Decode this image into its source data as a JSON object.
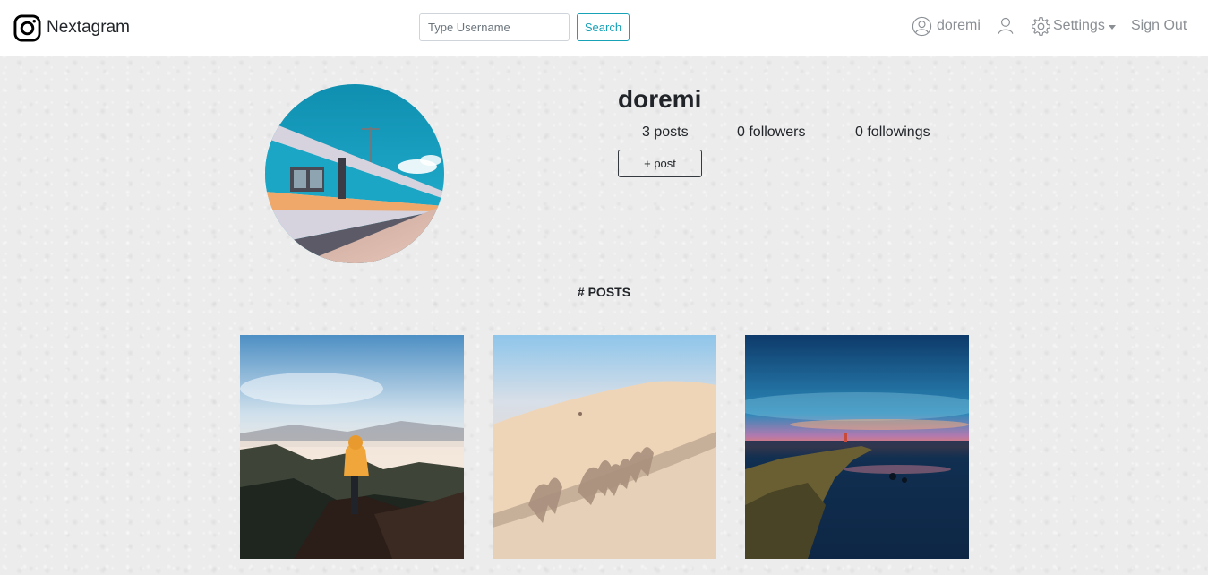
{
  "navbar": {
    "brand_name": "Nextagram",
    "search_placeholder": "Type Username",
    "search_label": "Search",
    "username": "doremi",
    "settings_label": "Settings",
    "signout_label": "Sign Out",
    "icons": [
      "instagram-icon",
      "user-circle-icon",
      "user-icon",
      "gear-icon",
      "caret-down-icon"
    ]
  },
  "profile": {
    "username": "doremi",
    "posts_count": "3 posts",
    "followers_count": "0 followers",
    "followings_count": "0 followings",
    "add_post_label": "+ post"
  },
  "posts_section": {
    "heading": "# POSTS",
    "posts": [
      {
        "subject": "hiker in yellow hoodie on misty mountain"
      },
      {
        "subject": "camel caravan shadows on desert dune"
      },
      {
        "subject": "person on rocky coast at sunset"
      }
    ]
  },
  "colors": {
    "accent": "#17a2b8",
    "nav_text": "#8a8f94",
    "text": "#212529"
  }
}
